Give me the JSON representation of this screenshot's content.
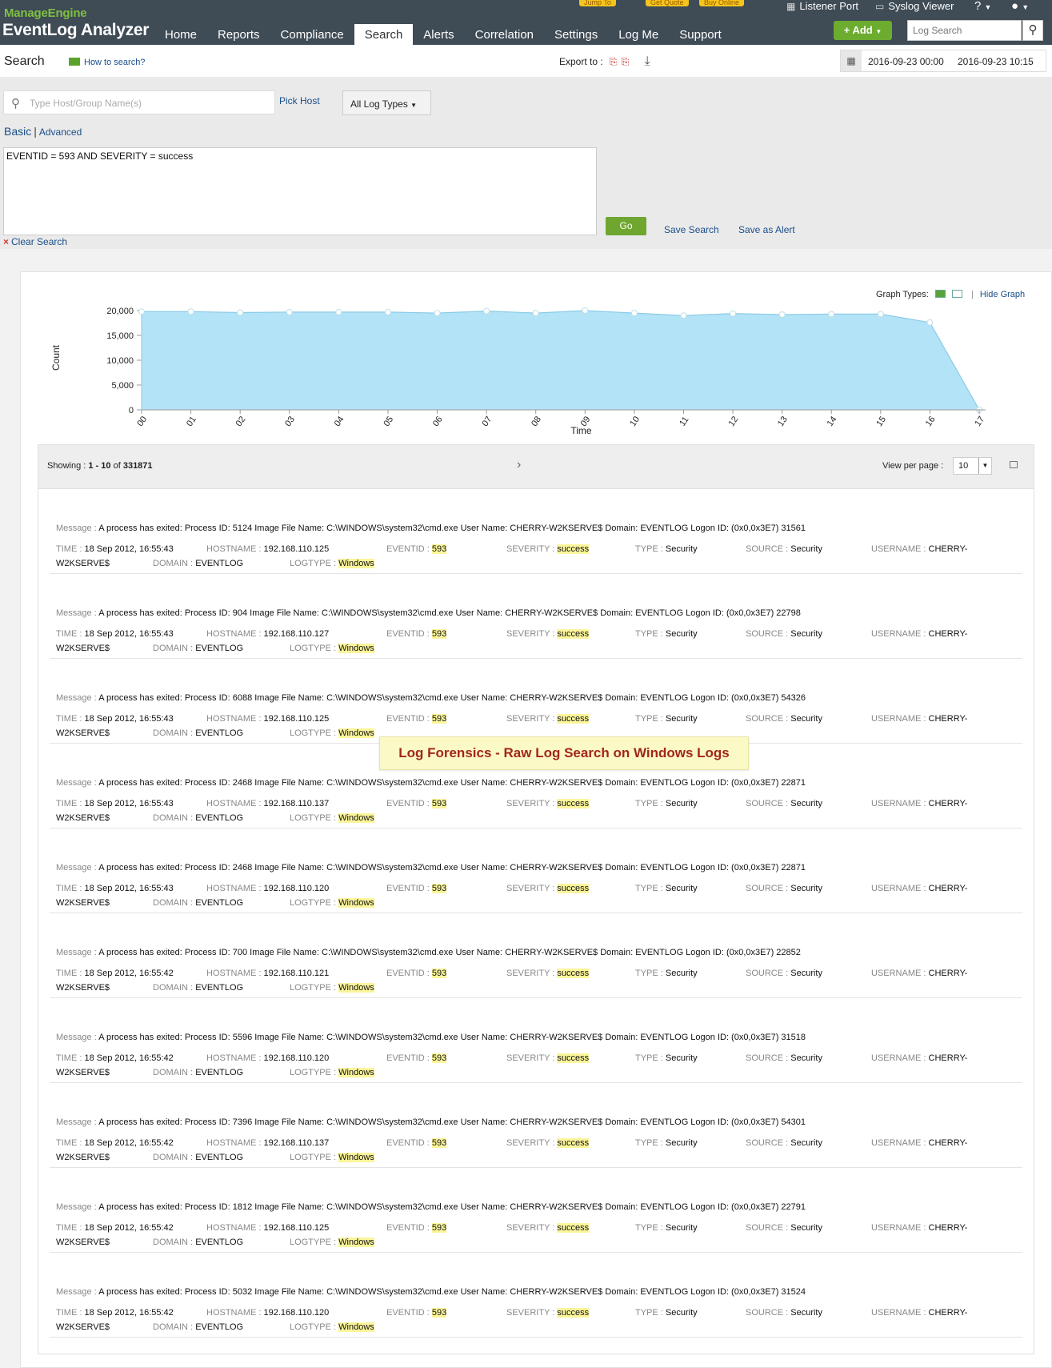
{
  "header": {
    "brand_top": "ManageEngine",
    "brand_main": "EventLog Analyzer",
    "nav": [
      "Home",
      "Reports",
      "Compliance",
      "Search",
      "Alerts",
      "Correlation",
      "Settings",
      "Log Me",
      "Support"
    ],
    "active_nav": "Search",
    "promos": [
      "Jump To",
      "Get Quote",
      "Buy Online"
    ],
    "listener_port": "Listener Port",
    "syslog_viewer": "Syslog Viewer",
    "help": "?",
    "add_label": "+ Add",
    "search_placeholder": "Log Search"
  },
  "subbar": {
    "title": "Search",
    "how_to": "How to search?",
    "export_label": "Export to :",
    "date_from": "2016-09-23 00:00",
    "date_to": "2016-09-23 10:15"
  },
  "search_panel": {
    "host_placeholder": "Type Host/Group Name(s)",
    "pick_host": "Pick Host",
    "log_types": "All Log Types",
    "tab_basic": "Basic",
    "tab_separator": "|",
    "tab_advanced": "Advanced",
    "query": "EVENTID = 593 AND SEVERITY = success",
    "go": "Go",
    "save_search": "Save Search",
    "save_alert": "Save as Alert",
    "clear": "Clear Search"
  },
  "graph_controls": {
    "label": "Graph Types:",
    "hide": "Hide Graph",
    "separator": "|"
  },
  "chart_data": {
    "type": "area",
    "x": [
      "00",
      "01",
      "02",
      "03",
      "04",
      "05",
      "06",
      "07",
      "08",
      "09",
      "10",
      "11",
      "12",
      "13",
      "14",
      "15",
      "16",
      "17"
    ],
    "values": [
      19800,
      19800,
      19600,
      19700,
      19700,
      19700,
      19500,
      19900,
      19500,
      20000,
      19500,
      19000,
      19400,
      19200,
      19300,
      19300,
      17600,
      0
    ],
    "xlabel": "Time",
    "ylabel": "Count",
    "ylim": [
      0,
      20000
    ],
    "yticks": [
      "20,000",
      "15,000",
      "10,000",
      "5,000",
      "0"
    ],
    "color": "#b3e3f7",
    "line_color": "#8ccbe6"
  },
  "list": {
    "showing_label": "Showing :",
    "range": "1 - 10",
    "of_label": "of",
    "total": "331871",
    "next": "›",
    "view_per_page_label": "View per page :",
    "view_per_page": "10"
  },
  "field_labels": {
    "message": "Message :",
    "time": "TIME :",
    "hostname": "HOSTNAME :",
    "eventid": "EVENTID :",
    "severity": "SEVERITY :",
    "type": "TYPE :",
    "source": "SOURCE :",
    "username": "USERNAME :",
    "domain": "DOMAIN :",
    "logtype": "LOGTYPE :"
  },
  "records": [
    {
      "message": "A process has exited: Process ID: 5124 Image File Name: C:\\WINDOWS\\system32\\cmd.exe User Name: CHERRY-W2KSERVE$ Domain: EVENTLOG Logon ID: (0x0,0x3E7) 31561",
      "time": "18 Sep 2012, 16:55:43",
      "hostname": "192.168.110.125",
      "eventid": "593",
      "severity": "success",
      "type": "Security",
      "source": "Security",
      "username_1": "CHERRY-",
      "username_2": "W2KSERVE$",
      "domain": "EVENTLOG",
      "logtype": "Windows"
    },
    {
      "message": "A process has exited: Process ID: 904 Image File Name: C:\\WINDOWS\\system32\\cmd.exe User Name: CHERRY-W2KSERVE$ Domain: EVENTLOG Logon ID: (0x0,0x3E7) 22798",
      "time": "18 Sep 2012, 16:55:43",
      "hostname": "192.168.110.127",
      "eventid": "593",
      "severity": "success",
      "type": "Security",
      "source": "Security",
      "username_1": "CHERRY-",
      "username_2": "W2KSERVE$",
      "domain": "EVENTLOG",
      "logtype": "Windows"
    },
    {
      "message": "A process has exited: Process ID: 6088 Image File Name: C:\\WINDOWS\\system32\\cmd.exe User Name: CHERRY-W2KSERVE$ Domain: EVENTLOG Logon ID: (0x0,0x3E7) 54326",
      "time": "18 Sep 2012, 16:55:43",
      "hostname": "192.168.110.125",
      "eventid": "593",
      "severity": "success",
      "type": "Security",
      "source": "Security",
      "username_1": "CHERRY-",
      "username_2": "W2KSERVE$",
      "domain": "EVENTLOG",
      "logtype": "Windows"
    },
    {
      "message": "A process has exited: Process ID: 2468 Image File Name: C:\\WINDOWS\\system32\\cmd.exe User Name: CHERRY-W2KSERVE$ Domain: EVENTLOG Logon ID: (0x0,0x3E7) 22871",
      "time": "18 Sep 2012, 16:55:43",
      "hostname": "192.168.110.137",
      "eventid": "593",
      "severity": "success",
      "type": "Security",
      "source": "Security",
      "username_1": "CHERRY-",
      "username_2": "W2KSERVE$",
      "domain": "EVENTLOG",
      "logtype": "Windows"
    },
    {
      "message": "A process has exited: Process ID: 2468 Image File Name: C:\\WINDOWS\\system32\\cmd.exe User Name: CHERRY-W2KSERVE$ Domain: EVENTLOG Logon ID: (0x0,0x3E7) 22871",
      "time": "18 Sep 2012, 16:55:43",
      "hostname": "192.168.110.120",
      "eventid": "593",
      "severity": "success",
      "type": "Security",
      "source": "Security",
      "username_1": "CHERRY-",
      "username_2": "W2KSERVE$",
      "domain": "EVENTLOG",
      "logtype": "Windows"
    },
    {
      "message": "A process has exited: Process ID: 700 Image File Name: C:\\WINDOWS\\system32\\cmd.exe User Name: CHERRY-W2KSERVE$ Domain: EVENTLOG Logon ID: (0x0,0x3E7) 22852",
      "time": "18 Sep 2012, 16:55:42",
      "hostname": "192.168.110.121",
      "eventid": "593",
      "severity": "success",
      "type": "Security",
      "source": "Security",
      "username_1": "CHERRY-",
      "username_2": "W2KSERVE$",
      "domain": "EVENTLOG",
      "logtype": "Windows"
    },
    {
      "message": "A process has exited: Process ID: 5596 Image File Name: C:\\WINDOWS\\system32\\cmd.exe User Name: CHERRY-W2KSERVE$ Domain: EVENTLOG Logon ID: (0x0,0x3E7) 31518",
      "time": "18 Sep 2012, 16:55:42",
      "hostname": "192.168.110.120",
      "eventid": "593",
      "severity": "success",
      "type": "Security",
      "source": "Security",
      "username_1": "CHERRY-",
      "username_2": "W2KSERVE$",
      "domain": "EVENTLOG",
      "logtype": "Windows"
    },
    {
      "message": "A process has exited: Process ID: 7396 Image File Name: C:\\WINDOWS\\system32\\cmd.exe User Name: CHERRY-W2KSERVE$ Domain: EVENTLOG Logon ID: (0x0,0x3E7) 54301",
      "time": "18 Sep 2012, 16:55:42",
      "hostname": "192.168.110.137",
      "eventid": "593",
      "severity": "success",
      "type": "Security",
      "source": "Security",
      "username_1": "CHERRY-",
      "username_2": "W2KSERVE$",
      "domain": "EVENTLOG",
      "logtype": "Windows"
    },
    {
      "message": "A process has exited: Process ID: 1812 Image File Name: C:\\WINDOWS\\system32\\cmd.exe User Name: CHERRY-W2KSERVE$ Domain: EVENTLOG Logon ID: (0x0,0x3E7) 22791",
      "time": "18 Sep 2012, 16:55:42",
      "hostname": "192.168.110.125",
      "eventid": "593",
      "severity": "success",
      "type": "Security",
      "source": "Security",
      "username_1": "CHERRY-",
      "username_2": "W2KSERVE$",
      "domain": "EVENTLOG",
      "logtype": "Windows"
    },
    {
      "message": "A process has exited: Process ID: 5032 Image File Name: C:\\WINDOWS\\system32\\cmd.exe User Name: CHERRY-W2KSERVE$ Domain: EVENTLOG Logon ID: (0x0,0x3E7) 31524",
      "time": "18 Sep 2012, 16:55:42",
      "hostname": "192.168.110.120",
      "eventid": "593",
      "severity": "success",
      "type": "Security",
      "source": "Security",
      "username_1": "CHERRY-",
      "username_2": "W2KSERVE$",
      "domain": "EVENTLOG",
      "logtype": "Windows"
    }
  ],
  "caption": "Log Forensics - Raw Log Search on Windows Logs"
}
